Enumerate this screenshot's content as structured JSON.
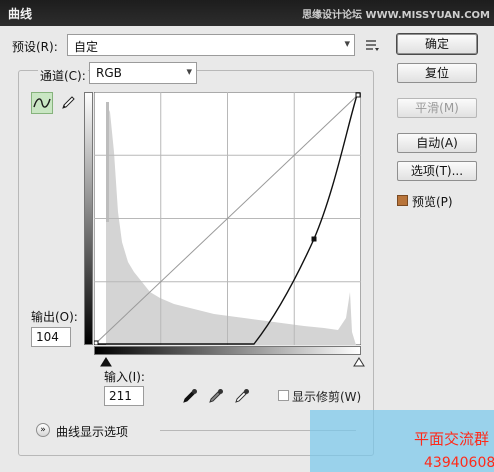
{
  "window": {
    "title": "曲线",
    "watermark": "思缘设计论坛 WWW.MISSYUAN.COM"
  },
  "preset": {
    "label": "预设(R):",
    "value": "自定"
  },
  "channel": {
    "label": "通道(C):",
    "value": "RGB"
  },
  "buttons": {
    "ok": "确定",
    "reset": "复位",
    "smooth": "平滑(M)",
    "auto": "自动(A)",
    "options": "选项(T)..."
  },
  "preview": {
    "label": "预览(P)",
    "checked": true
  },
  "output": {
    "label": "输出(O):",
    "value": "104"
  },
  "input": {
    "label": "输入(I):",
    "value": "211"
  },
  "show_clipping": {
    "label": "显示修剪(W)",
    "checked": false
  },
  "curve_display_options": {
    "label": "曲线显示选项"
  },
  "icons": {
    "preset_menu": "preset-options-icon",
    "curve_tool": "curve-point-tool-icon",
    "pencil_tool": "pencil-tool-icon",
    "eyedroppers": [
      "black-point-eyedropper-icon",
      "gray-point-eyedropper-icon",
      "white-point-eyedropper-icon"
    ],
    "expand": "expand-chevron-icon"
  },
  "colors": {
    "preview_swatch": "#b8743a",
    "title_bar": "#242424",
    "dialog_bg": "#e9e9e9",
    "active_tool": "#c9e6c3"
  },
  "curve": {
    "control_points": [
      [
        0,
        0
      ],
      [
        211,
        104
      ],
      [
        255,
        255
      ]
    ],
    "clipped_black_input": 153,
    "histogram_note": "gray histogram behind grid"
  },
  "overlay": {
    "line1": "平面交流群",
    "line2": "43940608"
  }
}
